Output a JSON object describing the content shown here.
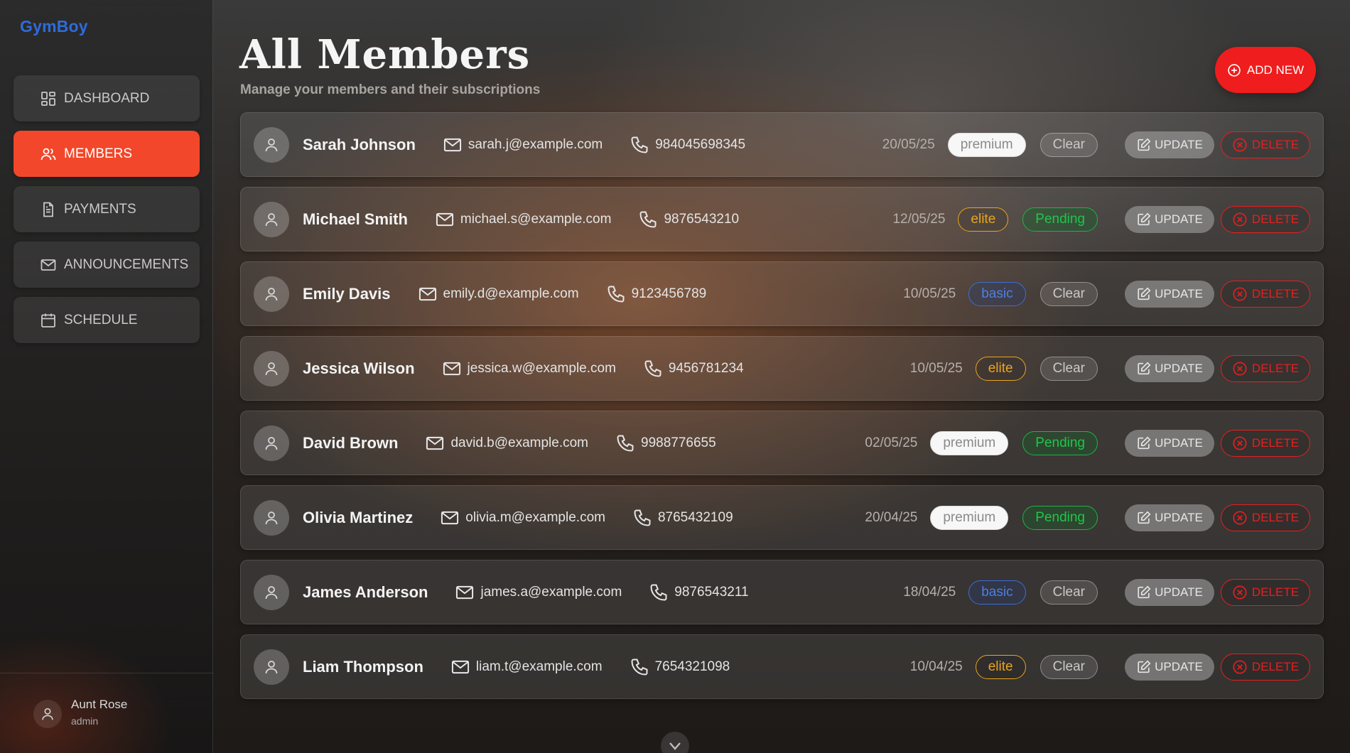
{
  "brand": "GymBoy",
  "nav": [
    {
      "label": "DASHBOARD",
      "icon": "dashboard-icon",
      "active": false
    },
    {
      "label": "MEMBERS",
      "icon": "users-icon",
      "active": true
    },
    {
      "label": "PAYMENTS",
      "icon": "document-icon",
      "active": false
    },
    {
      "label": "ANNOUNCEMENTS",
      "icon": "mail-icon",
      "active": false
    },
    {
      "label": "SCHEDULE",
      "icon": "calendar-icon",
      "active": false
    }
  ],
  "user": {
    "name": "Aunt Rose",
    "role": "admin"
  },
  "page": {
    "title": "All Members",
    "subtitle": "Manage your members and their subscriptions",
    "add_label": "ADD NEW"
  },
  "actions": {
    "update_label": "UPDATE",
    "delete_label": "DELETE"
  },
  "members": [
    {
      "name": "Sarah Johnson",
      "email": "sarah.j@example.com",
      "phone": "984045698345",
      "date": "20/05/25",
      "tier": "premium",
      "status": "Clear"
    },
    {
      "name": "Michael Smith",
      "email": "michael.s@example.com",
      "phone": "9876543210",
      "date": "12/05/25",
      "tier": "elite",
      "status": "Pending"
    },
    {
      "name": "Emily Davis",
      "email": "emily.d@example.com",
      "phone": "9123456789",
      "date": "10/05/25",
      "tier": "basic",
      "status": "Clear"
    },
    {
      "name": "Jessica Wilson",
      "email": "jessica.w@example.com",
      "phone": "9456781234",
      "date": "10/05/25",
      "tier": "elite",
      "status": "Clear"
    },
    {
      "name": "David Brown",
      "email": "david.b@example.com",
      "phone": "9988776655",
      "date": "02/05/25",
      "tier": "premium",
      "status": "Pending"
    },
    {
      "name": "Olivia Martinez",
      "email": "olivia.m@example.com",
      "phone": "8765432109",
      "date": "20/04/25",
      "tier": "premium",
      "status": "Pending"
    },
    {
      "name": "James Anderson",
      "email": "james.a@example.com",
      "phone": "9876543211",
      "date": "18/04/25",
      "tier": "basic",
      "status": "Clear"
    },
    {
      "name": "Liam Thompson",
      "email": "liam.t@example.com",
      "phone": "7654321098",
      "date": "10/04/25",
      "tier": "elite",
      "status": "Clear"
    }
  ],
  "colors": {
    "accent": "#f2472a",
    "brand": "#2f6bd8",
    "delete": "#e52020",
    "pending": "#21c549",
    "elite": "#e9a51e",
    "basic": "#4d7fe0"
  }
}
